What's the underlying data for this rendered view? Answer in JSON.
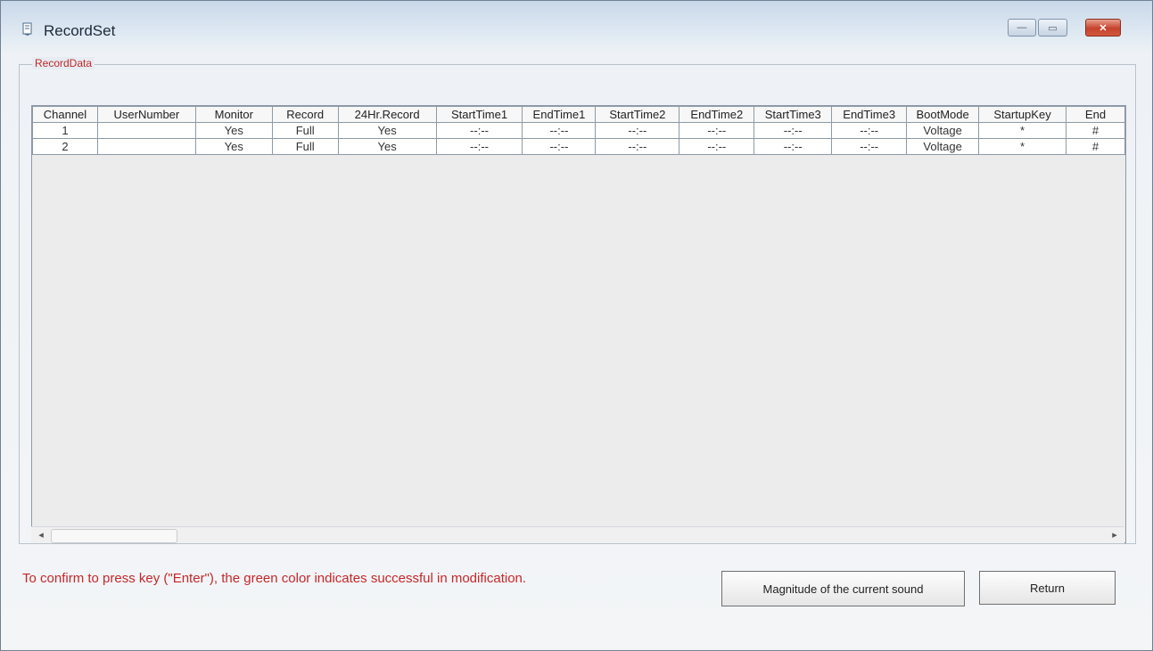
{
  "window": {
    "title": "RecordSet",
    "controls": {
      "minimize": "—",
      "maximize": "▭",
      "close": "✕"
    }
  },
  "group": {
    "title": "RecordData"
  },
  "table": {
    "columns": [
      "Channel",
      "UserNumber",
      "Monitor",
      "Record",
      "24Hr.Record",
      "StartTime1",
      "EndTime1",
      "StartTime2",
      "EndTime2",
      "StartTime3",
      "EndTime3",
      "BootMode",
      "StartupKey",
      "End"
    ],
    "rows": [
      [
        "1",
        "",
        "Yes",
        "Full",
        "Yes",
        "--:--",
        "--:--",
        "--:--",
        "--:--",
        "--:--",
        "--:--",
        "Voltage",
        "*",
        "#"
      ],
      [
        "2",
        "",
        "Yes",
        "Full",
        "Yes",
        "--:--",
        "--:--",
        "--:--",
        "--:--",
        "--:--",
        "--:--",
        "Voltage",
        "*",
        "#"
      ]
    ]
  },
  "scrollbar": {
    "left_arrow": "◂",
    "right_arrow": "▸"
  },
  "footer": {
    "hint": "To confirm to press key (\"Enter\"), the green color indicates successful in modification.",
    "magnitude_label": "Magnitude of the current sound",
    "return_label": "Return"
  },
  "colors": {
    "accent_red": "#c3282a",
    "grid_line": "#8f9aa6",
    "title_gradient_top": "#c9d8e9"
  }
}
